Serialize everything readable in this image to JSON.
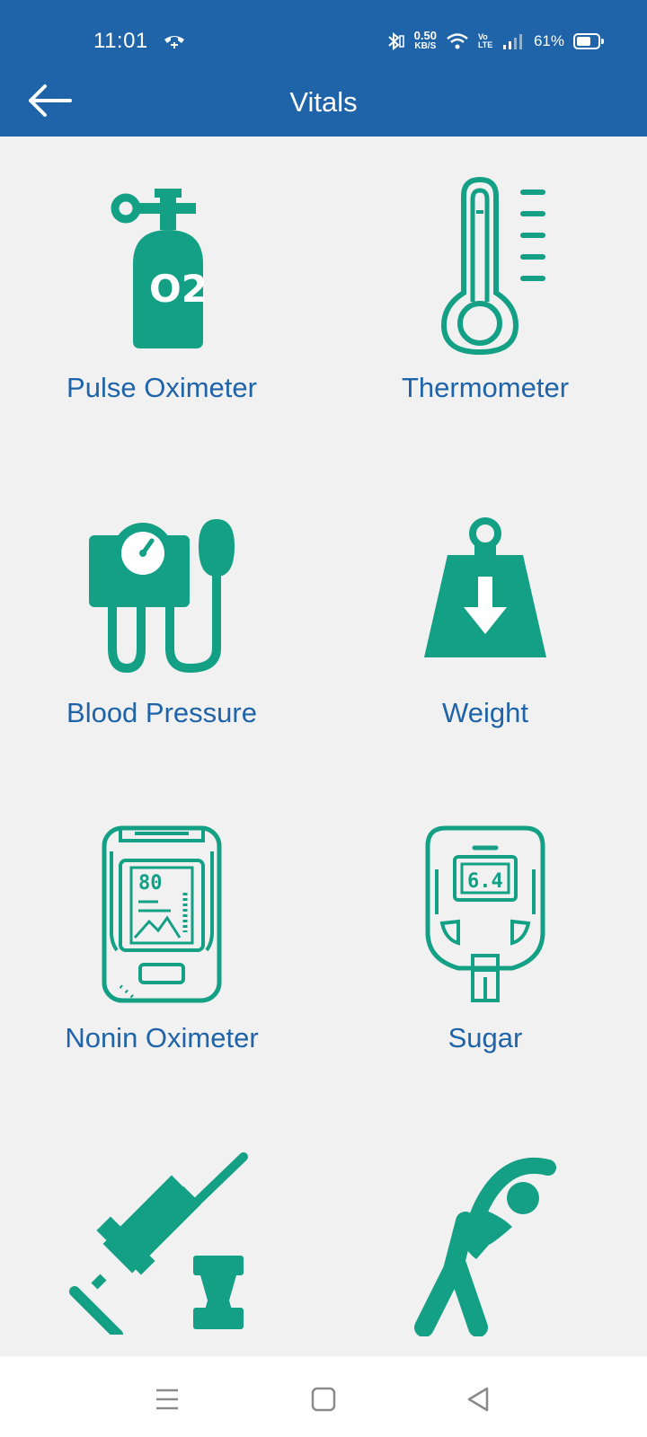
{
  "status_bar": {
    "time": "11:01",
    "net_speed_value": "0.50",
    "net_speed_unit": "KB/S",
    "volte_label": "Vo LTE",
    "battery": "61%"
  },
  "app_bar": {
    "title": "Vitals",
    "back_icon": "arrow-left-icon"
  },
  "vitals": [
    {
      "label": "Pulse Oximeter",
      "icon": "oxygen-cylinder-icon",
      "icon_text": "O2"
    },
    {
      "label": "Thermometer",
      "icon": "thermometer-icon"
    },
    {
      "label": "Blood Pressure",
      "icon": "blood-pressure-monitor-icon"
    },
    {
      "label": "Weight",
      "icon": "weight-icon"
    },
    {
      "label": "Nonin Oximeter",
      "icon": "finger-oximeter-icon",
      "icon_text": "80"
    },
    {
      "label": "Sugar",
      "icon": "glucometer-icon",
      "icon_text": "6.4"
    },
    {
      "label": "",
      "icon": "syringe-vial-icon"
    },
    {
      "label": "",
      "icon": "stretching-exercise-icon"
    }
  ],
  "nav_bar": {
    "items": [
      "menu-icon",
      "home-icon",
      "back-triangle-icon"
    ]
  },
  "colors": {
    "primary": "#1f63a8",
    "accent": "#13a085",
    "background": "#f1f1f1"
  }
}
